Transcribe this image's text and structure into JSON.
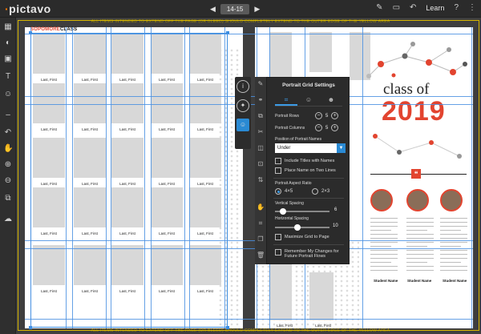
{
  "app": {
    "logo": "pictavo"
  },
  "topbar": {
    "page_range": "14-15",
    "prev_icon": "prev-arrow-icon",
    "next_icon": "next-arrow-icon",
    "learn_label": "Learn"
  },
  "bleed": {
    "top_text": "ALL ITEMS INTENDED TO EXTEND OFF THE PAGE (OR BLEED) SHOULD COMPLETELY EXTEND TO THE OUTER EDGE OF THE YELLOW AREA",
    "bottom_text": "ALL ITEMS INTENDED TO EXTEND OFF THE PAGE (OR BLEED) SHOULD COMPLETELY EXTEND TO THE OUTER EDGE OF THE YELLOW AREA"
  },
  "left_page": {
    "section_title_red": "SOPOMORE",
    "section_title_black": "CLASS",
    "portrait_label": "Last, First"
  },
  "right_page": {
    "heading_top": "class of",
    "heading_year": "2019",
    "quote_icon": "quote-icon",
    "students": [
      {
        "name": "Student Name"
      },
      {
        "name": "Student Name"
      },
      {
        "name": "Student Name"
      }
    ]
  },
  "panel": {
    "title": "Portrait Grid Settings",
    "tabs": [
      "grid-tab-icon",
      "person-tab-icon",
      "group-tab-icon"
    ],
    "portrait_rows_label": "Portrait Rows",
    "portrait_rows_value": "5",
    "portrait_columns_label": "Portrait Columns",
    "portrait_columns_value": "5",
    "position_label": "Position of Portrait Names",
    "position_value": "Under",
    "include_titles": "Include Titles with Names",
    "two_lines": "Place Name on Two Lines",
    "aspect_label": "Portrait Aspect Ratio",
    "aspect_opt1": "4×5",
    "aspect_opt2": "2×3",
    "aspect_selected": "4×5",
    "vertical_label": "Vertical Spacing",
    "vertical_value": "6",
    "horizontal_label": "Horizontal Spacing",
    "horizontal_value": "10",
    "maximize_label": "Maximize Grid to Page",
    "remember_label_1": "Remember My Changes for",
    "remember_label_2": "Future Portrait Flows"
  },
  "colors": {
    "accent": "#2a8ad4",
    "brand_red": "#e2442f",
    "bleed_yellow": "#d6b600"
  }
}
